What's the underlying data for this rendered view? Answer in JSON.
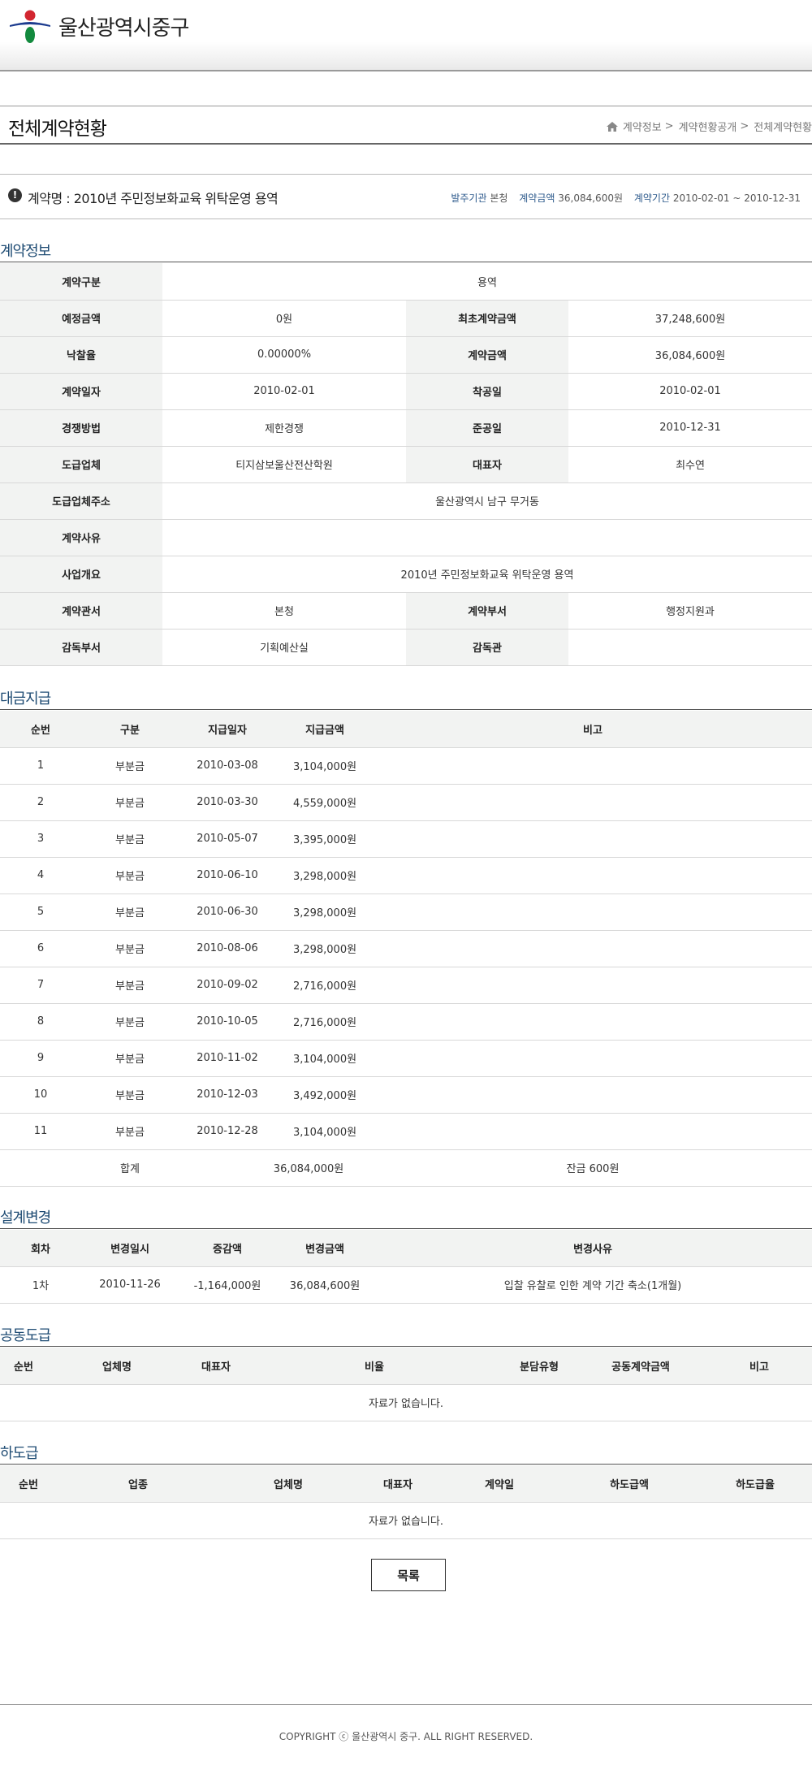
{
  "header": {
    "logo_text": "울산광역시중구"
  },
  "page": {
    "title": "전체계약현황",
    "breadcrumb": [
      "계약정보",
      "계약현황공개",
      "전체계약현황"
    ]
  },
  "summary": {
    "contract_label": "계약명 : 2010년 주민정보화교육 위탁운영 용역",
    "org_key": "발주기관",
    "org_val": "본청",
    "amount_key": "계약금액",
    "amount_val": "36,084,600원",
    "period_key": "계약기간",
    "period_val": "2010-02-01 ~ 2010-12-31"
  },
  "contract_info": {
    "heading": "계약정보",
    "type_label": "계약구분",
    "type_value": "용역",
    "est_label": "예정금액",
    "est_value": "0원",
    "init_label": "최초계약금액",
    "init_value": "37,248,600원",
    "rate_label": "낙찰율",
    "rate_value": "0.00000%",
    "amt_label": "계약금액",
    "amt_value": "36,084,600원",
    "date_label": "계약일자",
    "date_value": "2010-02-01",
    "start_label": "착공일",
    "start_value": "2010-02-01",
    "method_label": "경쟁방법",
    "method_value": "제한경쟁",
    "end_label": "준공일",
    "end_value": "2010-12-31",
    "company_label": "도급업체",
    "company_value": "티지삼보울산전산학원",
    "rep_label": "대표자",
    "rep_value": "최수연",
    "addr_label": "도급업체주소",
    "addr_value": "울산광역시 남구 무거동",
    "reason_label": "계약사유",
    "reason_value": "",
    "overview_label": "사업개요",
    "overview_value": "2010년 주민정보화교육 위탁운영 용역",
    "office_label": "계약관서",
    "office_value": "본청",
    "dept_label": "계약부서",
    "dept_value": "행정지원과",
    "sup_dept_label": "감독부서",
    "sup_dept_value": "기획예산실",
    "sup_label": "감독관",
    "sup_value": ""
  },
  "payments": {
    "heading": "대금지급",
    "columns": [
      "순번",
      "구분",
      "지급일자",
      "지급금액",
      "비고"
    ],
    "rows": [
      [
        "1",
        "부분금",
        "2010-03-08",
        "3,104,000원",
        ""
      ],
      [
        "2",
        "부분금",
        "2010-03-30",
        "4,559,000원",
        ""
      ],
      [
        "3",
        "부분금",
        "2010-05-07",
        "3,395,000원",
        ""
      ],
      [
        "4",
        "부분금",
        "2010-06-10",
        "3,298,000원",
        ""
      ],
      [
        "5",
        "부분금",
        "2010-06-30",
        "3,298,000원",
        ""
      ],
      [
        "6",
        "부분금",
        "2010-08-06",
        "3,298,000원",
        ""
      ],
      [
        "7",
        "부분금",
        "2010-09-02",
        "2,716,000원",
        ""
      ],
      [
        "8",
        "부분금",
        "2010-10-05",
        "2,716,000원",
        ""
      ],
      [
        "9",
        "부분금",
        "2010-11-02",
        "3,104,000원",
        ""
      ],
      [
        "10",
        "부분금",
        "2010-12-03",
        "3,492,000원",
        ""
      ],
      [
        "11",
        "부분금",
        "2010-12-28",
        "3,104,000원",
        ""
      ]
    ],
    "total_label": "합계",
    "total_amount": "36,084,000원",
    "total_note": "잔금 600원"
  },
  "design_changes": {
    "heading": "설계변경",
    "columns": [
      "회차",
      "변경일시",
      "증감액",
      "변경금액",
      "변경사유"
    ],
    "rows": [
      [
        "1차",
        "2010-11-26",
        "-1,164,000원",
        "36,084,600원",
        "입찰 유찰로 인한 계약 기간 축소(1개월)"
      ]
    ]
  },
  "joint": {
    "heading": "공동도급",
    "columns": [
      "순번",
      "업체명",
      "대표자",
      "비율",
      "분담유형",
      "공동계약금액",
      "비고"
    ],
    "empty": "자료가 없습니다."
  },
  "subcontract": {
    "heading": "하도급",
    "columns": [
      "순번",
      "업종",
      "업체명",
      "대표자",
      "계약일",
      "하도급액",
      "하도급율"
    ],
    "empty": "자료가 없습니다."
  },
  "actions": {
    "list_button": "목록"
  },
  "footer": {
    "copyright": "COPYRIGHT ⓒ 울산광역시 중구. ALL RIGHT RESERVED."
  }
}
